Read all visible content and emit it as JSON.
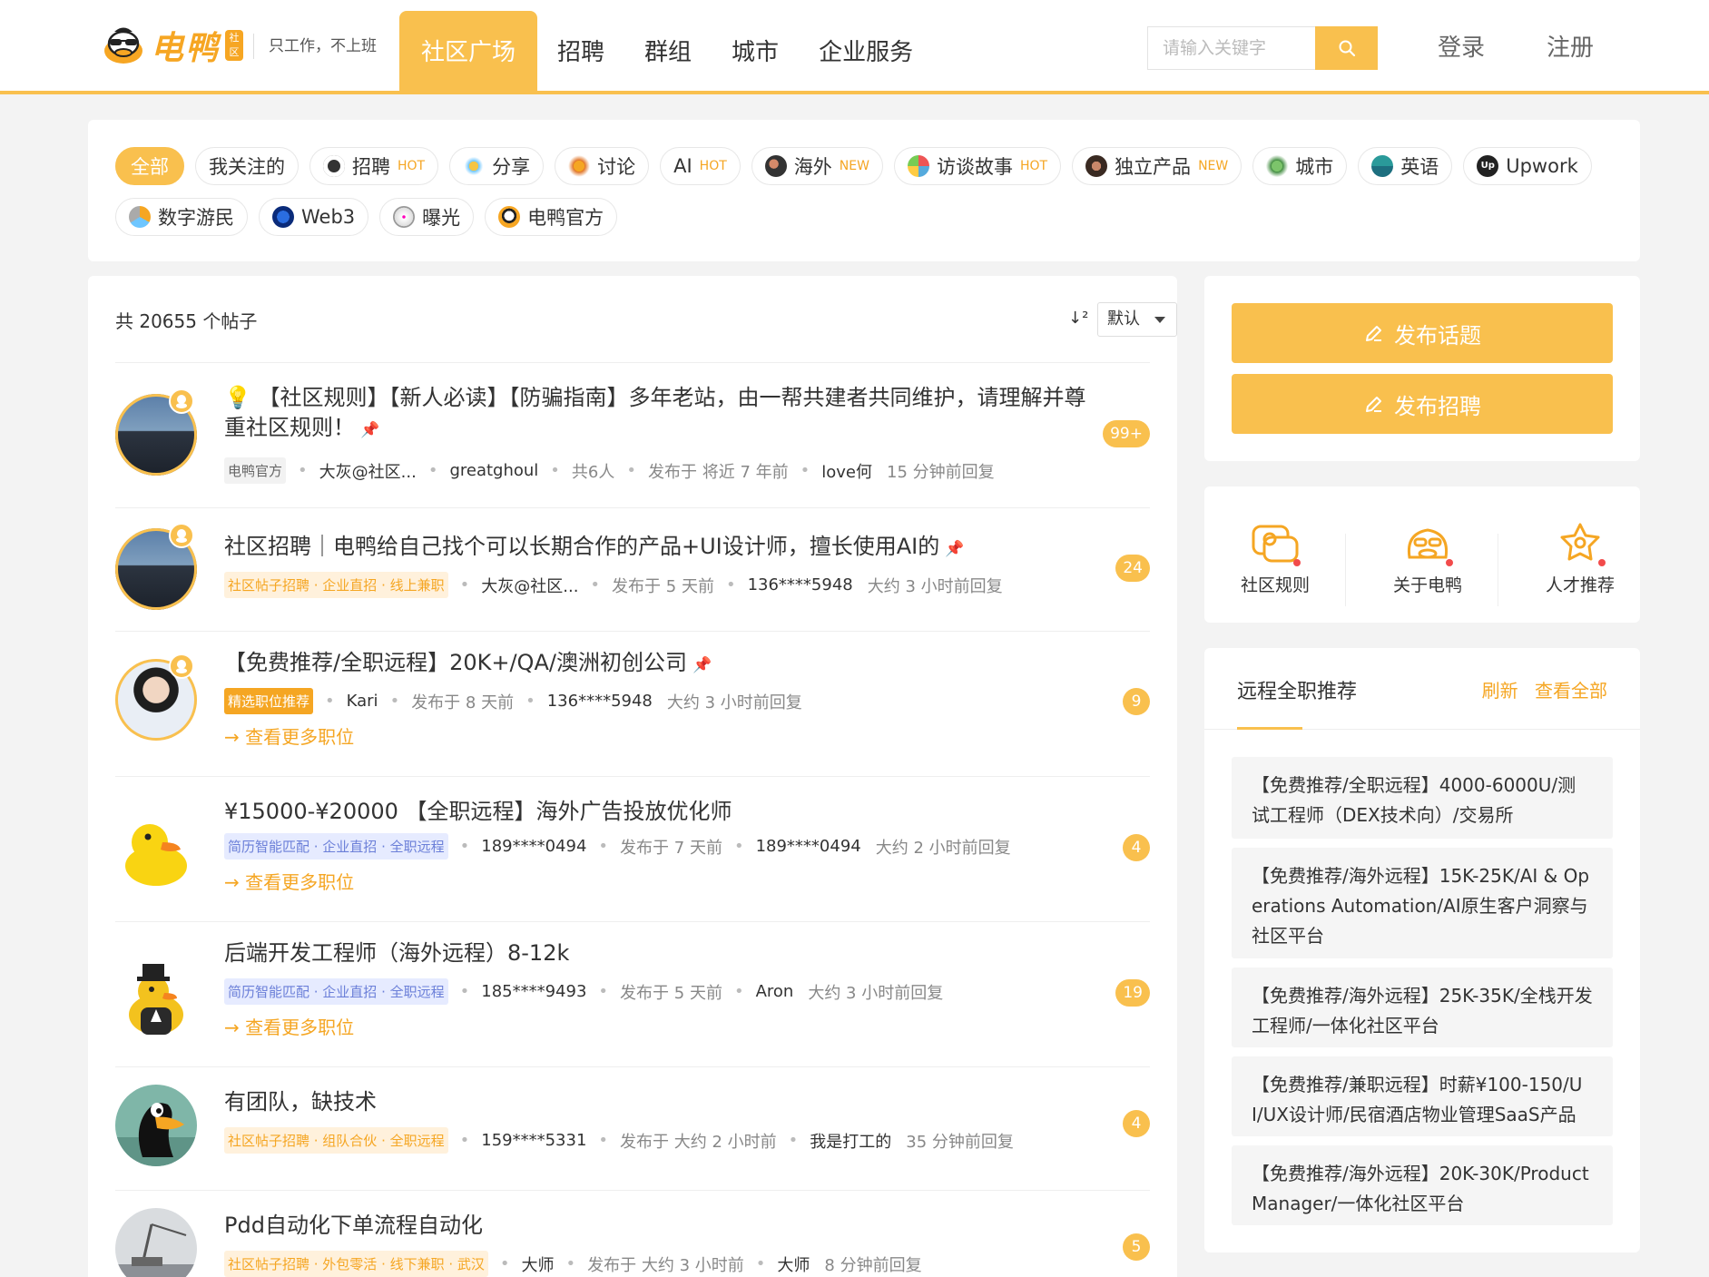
{
  "header": {
    "logo_text": "电鸭",
    "logo_badge": "社区",
    "slogan": "只工作，不上班",
    "nav": [
      "社区广场",
      "招聘",
      "群组",
      "城市",
      "企业服务"
    ],
    "search_placeholder": "请输入关键字",
    "login": "登录",
    "register": "注册"
  },
  "tags": [
    {
      "label": "全部"
    },
    {
      "label": "我关注的"
    },
    {
      "label": "招聘",
      "badge": "HOT"
    },
    {
      "label": "分享"
    },
    {
      "label": "讨论"
    },
    {
      "label": "AI",
      "badge": "HOT"
    },
    {
      "label": "海外",
      "badge": "NEW"
    },
    {
      "label": "访谈故事",
      "badge": "HOT"
    },
    {
      "label": "独立产品",
      "badge": "NEW"
    },
    {
      "label": "城市"
    },
    {
      "label": "英语"
    },
    {
      "label": "Upwork"
    },
    {
      "label": "数字游民"
    },
    {
      "label": "Web3"
    },
    {
      "label": "曝光"
    },
    {
      "label": "电鸭官方"
    }
  ],
  "posts_header": {
    "count": "共 20655 个帖子",
    "sort": "默认"
  },
  "posts": [
    {
      "title": "💡 【社区规则】【新人必读】【防骗指南】多年老站，由一帮共建者共同维护，请理解并尊重社区规则！",
      "pinned": "📌",
      "label": "电鸭官方",
      "author": "大灰@社区...",
      "author2": "greatghoul",
      "extra": "共6人",
      "posted": "发布于 将近 7 年前",
      "replier": "love何",
      "replied": "15 分钟前回复",
      "replies": "99+"
    },
    {
      "title": "社区招聘｜电鸭给自己找个可以长期合作的产品+UI设计师，擅长使用AI的",
      "pinned": "📌",
      "label": "社区帖子招聘 · 企业直招 · 线上兼职",
      "author": "大灰@社区...",
      "posted": "发布于 5 天前",
      "replier": "136****5948",
      "replied": "大约 3 小时前回复",
      "replies": "24"
    },
    {
      "title": "【免费推荐/全职远程】20K+/QA/澳洲初创公司",
      "pinned": "📌",
      "label": "精选职位推荐",
      "author": "Kari",
      "posted": "发布于 8 天前",
      "replier": "136****5948",
      "replied": "大约 3 小时前回复",
      "more": "→ 查看更多职位",
      "replies": "9"
    },
    {
      "title": "¥15000-¥20000 【全职远程】海外广告投放优化师",
      "label": "简历智能匹配 · 企业直招 · 全职远程",
      "author": "189****0494",
      "posted": "发布于 7 天前",
      "replier": "189****0494",
      "replied": "大约 2 小时前回复",
      "more": "→ 查看更多职位",
      "replies": "4"
    },
    {
      "title": "后端开发工程师（海外远程）8-12k",
      "label": "简历智能匹配 · 企业直招 · 全职远程",
      "author": "185****9493",
      "posted": "发布于 5 天前",
      "replier": "Aron",
      "replied": "大约 3 小时前回复",
      "more": "→ 查看更多职位",
      "replies": "19"
    },
    {
      "title": "有团队，缺技术",
      "label": "社区帖子招聘 · 组队合伙 · 全职远程",
      "author": "159****5331",
      "posted": "发布于 大约 2 小时前",
      "replier": "我是打工的",
      "replied": "35 分钟前回复",
      "replies": "4"
    },
    {
      "title": "Pdd自动化下单流程自动化",
      "label": "社区帖子招聘 · 外包零活 · 线下兼职 · 武汉",
      "author": "大师",
      "posted": "发布于 大约 3 小时前",
      "replier": "大师",
      "replied": "8 分钟前回复",
      "replies": "5"
    }
  ],
  "sidebar": {
    "publish_topic": "发布话题",
    "publish_job": "发布招聘",
    "quick": [
      "社区规则",
      "关于电鸭",
      "人才推荐"
    ],
    "remote_title": "远程全职推荐",
    "refresh": "刷新",
    "view_all": "查看全部",
    "jobs": [
      "【免费推荐/全职远程】4000-6000U/测试工程师（DEX技术向）/交易所",
      "【免费推荐/海外远程】15K-25K/AI & Operations Automation/AI原生客户洞察与社区平台",
      "【免费推荐/海外远程】25K-35K/全栈开发工程师/一体化社区平台",
      "【免费推荐/兼职远程】时薪¥100-150/UI/UX设计师/民宿酒店物业管理SaaS产品",
      "【免费推荐/海外远程】20K-30K/Product Manager/一体化社区平台"
    ]
  },
  "colors": {
    "accent": "#f9c04e",
    "accent_text": "#f5a623"
  }
}
